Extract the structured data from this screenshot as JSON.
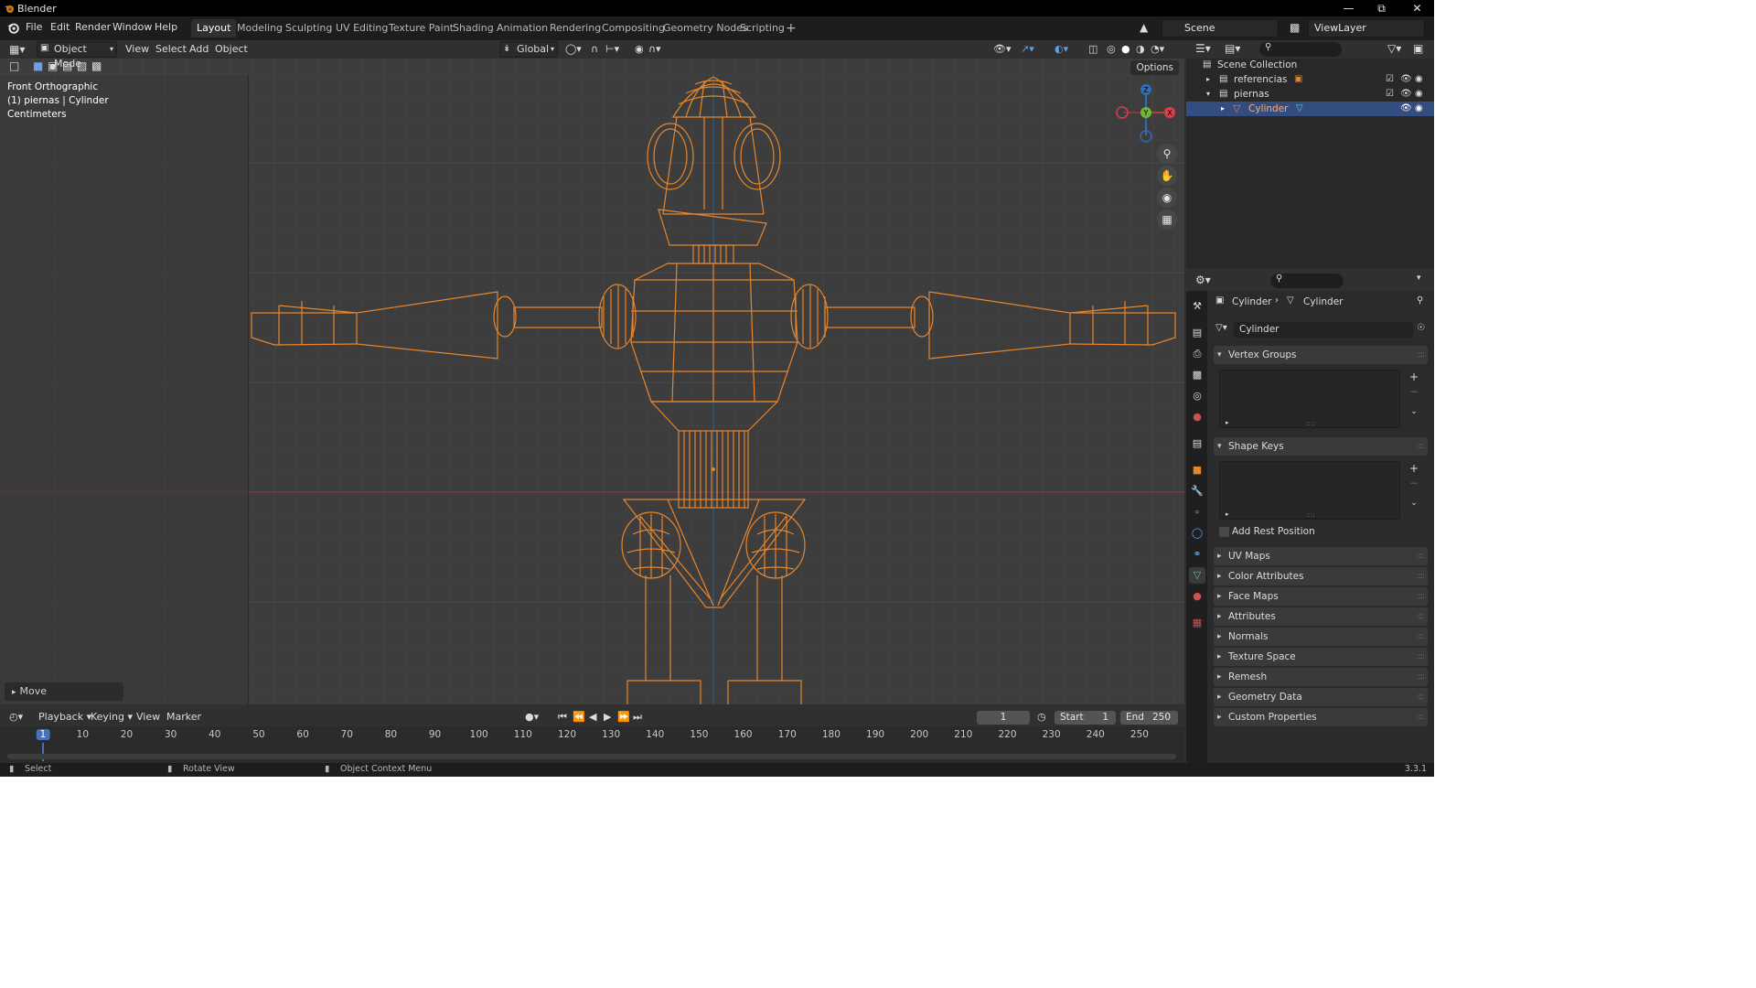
{
  "window": {
    "title": "Blender",
    "version": "3.3.1"
  },
  "menu": [
    "File",
    "Edit",
    "Render",
    "Window",
    "Help"
  ],
  "workspaces": [
    "Layout",
    "Modeling",
    "Sculpting",
    "UV Editing",
    "Texture Paint",
    "Shading",
    "Animation",
    "Rendering",
    "Compositing",
    "Geometry Nodes",
    "Scripting"
  ],
  "active_workspace": "Layout",
  "scene": {
    "name": "Scene",
    "view_layer": "ViewLayer"
  },
  "viewport": {
    "mode": "Object Mode",
    "menus": [
      "View",
      "Select",
      "Add",
      "Object"
    ],
    "transform_orientation": "Global",
    "options_label": "Options",
    "overlay": {
      "view_name": "Front Orthographic",
      "object_info": "(1) piernas | Cylinder",
      "units": "Centimeters"
    },
    "last_operator": "Move",
    "gizmo": {
      "z": "Z",
      "y": "Y",
      "x": "X"
    }
  },
  "timeline": {
    "menus": [
      "Playback",
      "Keying",
      "View",
      "Marker"
    ],
    "current_frame": "1",
    "start_label": "Start",
    "start": "1",
    "end_label": "End",
    "end": "250",
    "ticks": [
      "1",
      "10",
      "20",
      "30",
      "40",
      "50",
      "60",
      "70",
      "80",
      "90",
      "100",
      "110",
      "120",
      "130",
      "140",
      "150",
      "160",
      "170",
      "180",
      "190",
      "200",
      "210",
      "220",
      "230",
      "240",
      "250"
    ]
  },
  "status_bar": {
    "left": "Select",
    "middle": "Rotate View",
    "right": "Object Context Menu"
  },
  "outliner": {
    "root": "Scene Collection",
    "rows": [
      {
        "label": "referencias",
        "selected": false
      },
      {
        "label": "piernas",
        "selected": false
      },
      {
        "label": "Cylinder",
        "selected": true
      }
    ]
  },
  "properties": {
    "breadcrumb_object": "Cylinder",
    "breadcrumb_data": "Cylinder",
    "mesh_name": "Cylinder",
    "open_panels": [
      "Vertex Groups",
      "Shape Keys"
    ],
    "add_rest_position": "Add Rest Position",
    "closed_panels": [
      "UV Maps",
      "Color Attributes",
      "Face Maps",
      "Attributes",
      "Normals",
      "Texture Space",
      "Remesh",
      "Geometry Data",
      "Custom Properties"
    ]
  },
  "colors": {
    "selected_wire": "#e6862c",
    "accent_blue": "#4772b3",
    "viewport_bg": "#3d3d3d"
  }
}
